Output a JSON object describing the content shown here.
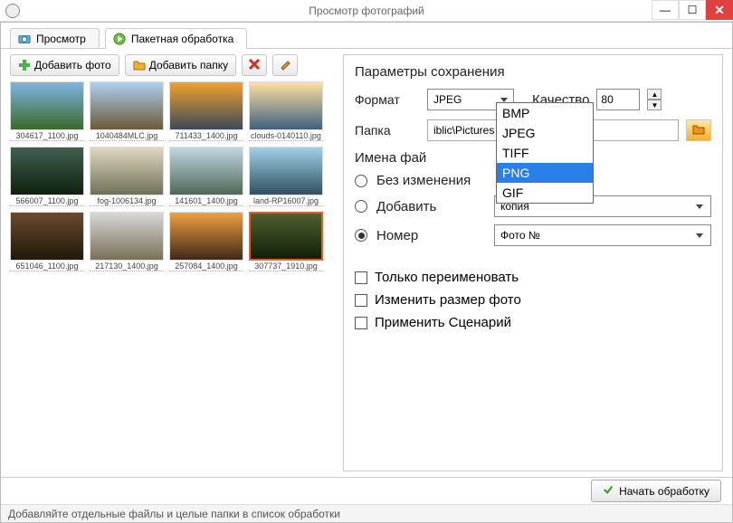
{
  "window": {
    "title": "Просмотр фотографий"
  },
  "tabs": {
    "view": "Просмотр",
    "batch": "Пакетная обработка"
  },
  "toolbar": {
    "add_photo": "Добавить фото",
    "add_folder": "Добавить папку"
  },
  "thumbnails": [
    {
      "name": "304617_1100.jpg"
    },
    {
      "name": "1040484MLC.jpg"
    },
    {
      "name": "711433_1400.jpg"
    },
    {
      "name": "clouds-0140110.jpg"
    },
    {
      "name": "566007_1100.jpg"
    },
    {
      "name": "fog-1006134.jpg"
    },
    {
      "name": "141601_1400.jpg"
    },
    {
      "name": "land-RP16007.jpg"
    },
    {
      "name": "651046_1100.jpg"
    },
    {
      "name": "217130_1400.jpg"
    },
    {
      "name": "257084_1400.jpg"
    },
    {
      "name": "307737_1910.jpg"
    }
  ],
  "save": {
    "group_title": "Параметры сохранения",
    "format_label": "Формат",
    "format_value": "JPEG",
    "format_options": [
      "BMP",
      "JPEG",
      "TIFF",
      "PNG",
      "GIF"
    ],
    "quality_label": "Качество",
    "quality_value": "80",
    "folder_label": "Папка",
    "folder_value": "iblic\\Pictures"
  },
  "names": {
    "group_title": "Имена фай",
    "no_change": "Без изменения",
    "add": "Добавить",
    "add_value": "копия",
    "number": "Номер",
    "number_value": "Фото №"
  },
  "options": {
    "rename_only": "Только переименовать",
    "resize": "Изменить размер фото",
    "scenario": "Применить Сценарий"
  },
  "footer": {
    "start": "Начать обработку"
  },
  "status": "Добавляйте отдельные файлы и целые папки в список обработки"
}
